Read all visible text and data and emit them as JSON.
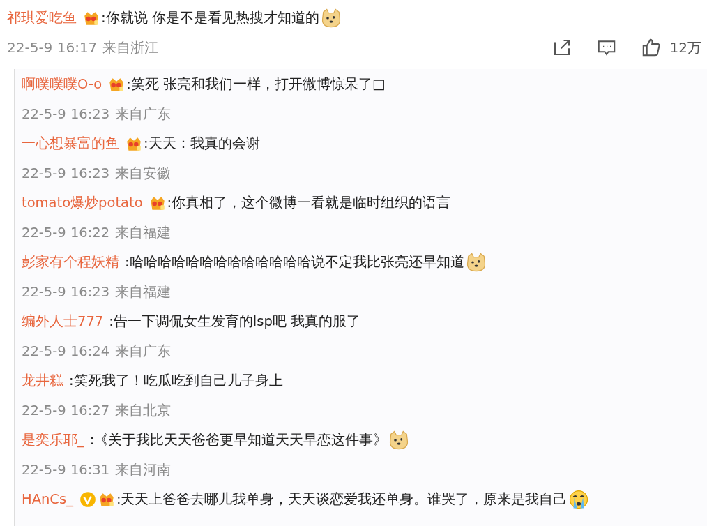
{
  "comment": {
    "user": "祁琪爱吃鱼",
    "badges": [
      {
        "kind": "crown"
      }
    ],
    "text": ":你就说 你是不是看见热搜才知道的",
    "emoji": {
      "kind": "doge"
    },
    "time": "22-5-9 16:17",
    "source": "来自浙江",
    "likes": "12万"
  },
  "replies": [
    {
      "user": "啊噗噗噗O-o",
      "badges": [
        {
          "kind": "crown"
        }
      ],
      "text": ":笑死  张亮和我们一样，打开微博惊呆了□",
      "time": "22-5-9 16:23",
      "source": "来自广东"
    },
    {
      "user": "一心想暴富的鱼",
      "badges": [
        {
          "kind": "crown"
        }
      ],
      "text": ":天天：我真的会谢",
      "time": "22-5-9 16:23",
      "source": "来自安徽"
    },
    {
      "user": "tomato爆炒potato",
      "badges": [
        {
          "kind": "crown"
        }
      ],
      "text": ":你真相了，这个微博一看就是临时组织的语言",
      "time": "22-5-9 16:22",
      "source": "来自福建"
    },
    {
      "user": "彭家有个程妖精",
      "text": ":哈哈哈哈哈哈哈哈哈哈哈哈哈说不定我比张亮还早知道",
      "emoji": {
        "kind": "doge"
      },
      "time": "22-5-9 16:23",
      "source": "来自福建"
    },
    {
      "user": "编外人士777",
      "text": ":告一下调侃女生发育的lsp吧 我真的服了",
      "time": "22-5-9 16:24",
      "source": "来自广东"
    },
    {
      "user": "龙井糕",
      "text": ":笑死我了！吃瓜吃到自己儿子身上",
      "time": "22-5-9 16:27",
      "source": "来自北京"
    },
    {
      "user": "是奕乐耶_",
      "text": ":《关于我比天天爸爸更早知道天天早恋这件事》",
      "emoji": {
        "kind": "doge"
      },
      "time": "22-5-9 16:31",
      "source": "来自河南"
    },
    {
      "user": "HAnCs_",
      "badges": [
        {
          "kind": "verified"
        },
        {
          "kind": "crown"
        }
      ],
      "text": ":天天上爸爸去哪儿我单身，天天谈恋爱我还单身。谁哭了，原来是我自己",
      "emoji": {
        "kind": "cry"
      }
    }
  ]
}
